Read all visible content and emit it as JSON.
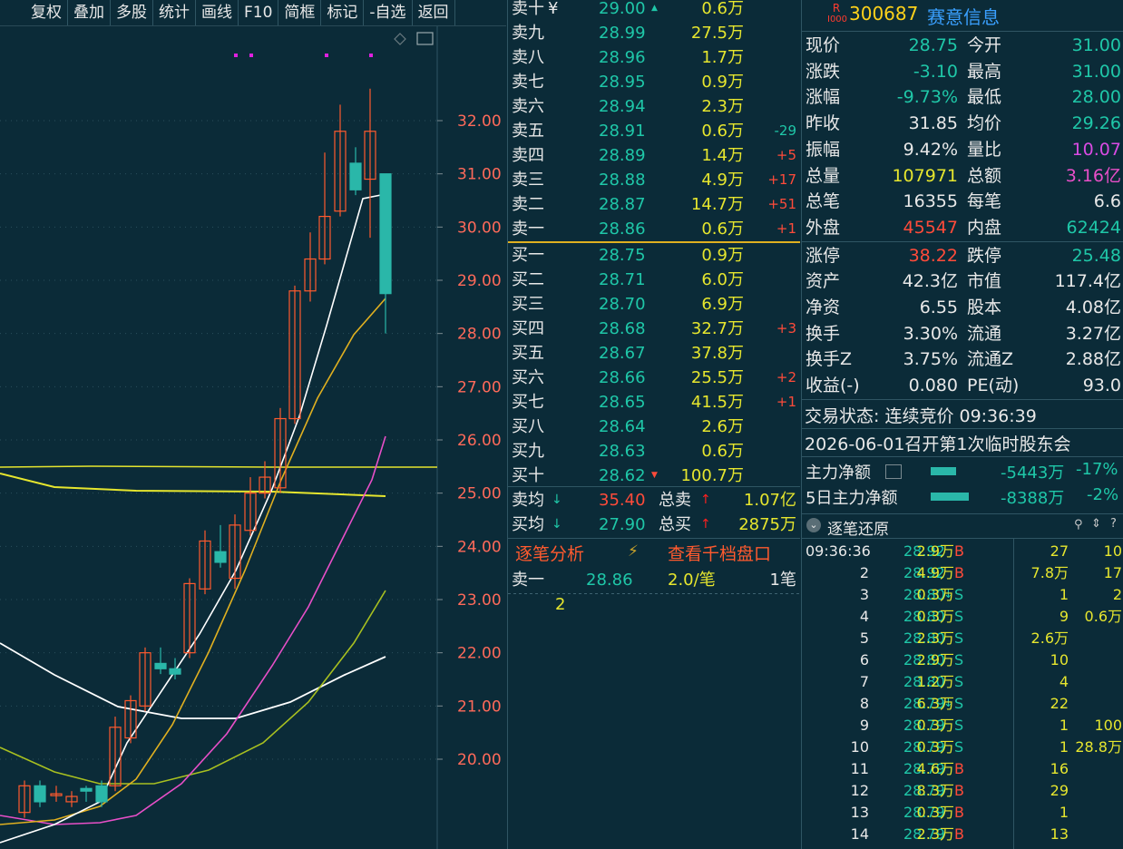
{
  "toolbar": [
    "复权",
    "叠加",
    "多股",
    "统计",
    "画线",
    "F10",
    "简框",
    "标记",
    "-自选",
    "返回"
  ],
  "chart": {
    "price_labels": [
      "32.00",
      "31.00",
      "30.00",
      "29.00",
      "28.00",
      "27.00",
      "26.00",
      "25.00",
      "24.00",
      "23.00",
      "22.00",
      "21.00",
      "20.00"
    ]
  },
  "orderbook": {
    "asks": [
      {
        "label": "卖十",
        "price": "29.00",
        "vol": "0.6万",
        "chg": ""
      },
      {
        "label": "卖九",
        "price": "28.99",
        "vol": "27.5万",
        "chg": ""
      },
      {
        "label": "卖八",
        "price": "28.96",
        "vol": "1.7万",
        "chg": ""
      },
      {
        "label": "卖七",
        "price": "28.95",
        "vol": "0.9万",
        "chg": ""
      },
      {
        "label": "卖六",
        "price": "28.94",
        "vol": "2.3万",
        "chg": ""
      },
      {
        "label": "卖五",
        "price": "28.91",
        "vol": "0.6万",
        "chg": "-29"
      },
      {
        "label": "卖四",
        "price": "28.89",
        "vol": "1.4万",
        "chg": "+5"
      },
      {
        "label": "卖三",
        "price": "28.88",
        "vol": "4.9万",
        "chg": "+17"
      },
      {
        "label": "卖二",
        "price": "28.87",
        "vol": "14.7万",
        "chg": "+51"
      },
      {
        "label": "卖一",
        "price": "28.86",
        "vol": "0.6万",
        "chg": "+1"
      }
    ],
    "ask10_mark": "¥",
    "bids": [
      {
        "label": "买一",
        "price": "28.75",
        "vol": "0.9万",
        "chg": ""
      },
      {
        "label": "买二",
        "price": "28.71",
        "vol": "6.0万",
        "chg": ""
      },
      {
        "label": "买三",
        "price": "28.70",
        "vol": "6.9万",
        "chg": ""
      },
      {
        "label": "买四",
        "price": "28.68",
        "vol": "32.7万",
        "chg": "+3"
      },
      {
        "label": "买五",
        "price": "28.67",
        "vol": "37.8万",
        "chg": ""
      },
      {
        "label": "买六",
        "price": "28.66",
        "vol": "25.5万",
        "chg": "+2"
      },
      {
        "label": "买七",
        "price": "28.65",
        "vol": "41.5万",
        "chg": "+1"
      },
      {
        "label": "买八",
        "price": "28.64",
        "vol": "2.6万",
        "chg": ""
      },
      {
        "label": "买九",
        "price": "28.63",
        "vol": "0.6万",
        "chg": ""
      },
      {
        "label": "买十",
        "price": "28.62",
        "vol": "100.7万",
        "chg": ""
      }
    ],
    "sell_avg_label": "卖均",
    "sell_avg": "35.40",
    "total_sell_label": "总卖",
    "total_sell": "1.07亿",
    "buy_avg_label": "买均",
    "buy_avg": "27.90",
    "total_buy_label": "总买",
    "total_buy": "2875万",
    "tab_left": "逐笔分析",
    "tab_right": "查看千档盘口",
    "detail_label": "卖一",
    "detail_price": "28.86",
    "detail_rate": "2.0/笔",
    "detail_count": "1笔",
    "detail_value": "2"
  },
  "quote": {
    "badge": "R",
    "badge_sub": "I000",
    "code": "300687",
    "name": "赛意信息",
    "rows": [
      [
        "现价",
        "28.75",
        "今开",
        "31.00"
      ],
      [
        "涨跌",
        "-3.10",
        "最高",
        "31.00"
      ],
      [
        "涨幅",
        "-9.73%",
        "最低",
        "28.00"
      ],
      [
        "昨收",
        "31.85",
        "均价",
        "29.26"
      ],
      [
        "振幅",
        "9.42%",
        "量比",
        "10.07"
      ],
      [
        "总量",
        "107971",
        "总额",
        "3.16亿"
      ],
      [
        "总笔",
        "16355",
        "每笔",
        "6.6"
      ],
      [
        "外盘",
        "45547",
        "内盘",
        "62424"
      ],
      [
        "涨停",
        "38.22",
        "跌停",
        "25.48"
      ],
      [
        "资产",
        "42.3亿",
        "市值",
        "117.4亿"
      ],
      [
        "净资",
        "6.55",
        "股本",
        "4.08亿"
      ],
      [
        "换手",
        "3.30%",
        "流通",
        "3.27亿"
      ],
      [
        "换手Z",
        "3.75%",
        "流通Z",
        "2.88亿"
      ],
      [
        "收益(-)",
        "0.080",
        "PE(动)",
        "93.0"
      ]
    ],
    "status": "交易状态: 连续竞价 09:36:39",
    "notice": "2026-06-01召开第1次临时股东会",
    "flow1_label": "主力净额",
    "flow1_val": "-5443万",
    "flow1_pct": "-17%",
    "flow2_label": "5日主力净额",
    "flow2_val": "-8388万",
    "flow2_pct": "-2%",
    "ticks_title": "逐笔还原",
    "ticks": [
      [
        "09:36:36",
        "28.92",
        "2.9万",
        "B",
        "27",
        "10"
      ],
      [
        "2",
        "28.92",
        "4.9万",
        "B",
        "7.8万",
        "17"
      ],
      [
        "3",
        "28.80",
        "0.3万",
        "S",
        "1",
        "2"
      ],
      [
        "4",
        "28.80",
        "0.3万",
        "S",
        "9",
        "0.6万"
      ],
      [
        "5",
        "28.80",
        "2.3万",
        "S",
        "2.6万",
        ""
      ],
      [
        "6",
        "28.80",
        "2.9万",
        "S",
        "10",
        ""
      ],
      [
        "7",
        "28.80",
        "1.2万",
        "S",
        "4",
        ""
      ],
      [
        "8",
        "28.79",
        "6.3万",
        "S",
        "22",
        ""
      ],
      [
        "9",
        "28.79",
        "0.3万",
        "S",
        "1",
        "100"
      ],
      [
        "10",
        "28.79",
        "0.3万",
        "S",
        "1",
        "28.8万"
      ],
      [
        "11",
        "28.79",
        "4.6万",
        "B",
        "16",
        ""
      ],
      [
        "12",
        "28.79",
        "8.3万",
        "B",
        "29",
        ""
      ],
      [
        "13",
        "28.79",
        "0.3万",
        "B",
        "1",
        ""
      ],
      [
        "14",
        "28.79",
        "2.3万",
        "B",
        "13",
        ""
      ]
    ]
  },
  "colors": {
    "bg": "#0b2b38",
    "up": "#ff5a2e",
    "down": "#2ab7a9",
    "ma5": "#ffffff",
    "ma10": "#e0b020",
    "ma20": "#e84fc8",
    "ma60": "#a8c020"
  }
}
